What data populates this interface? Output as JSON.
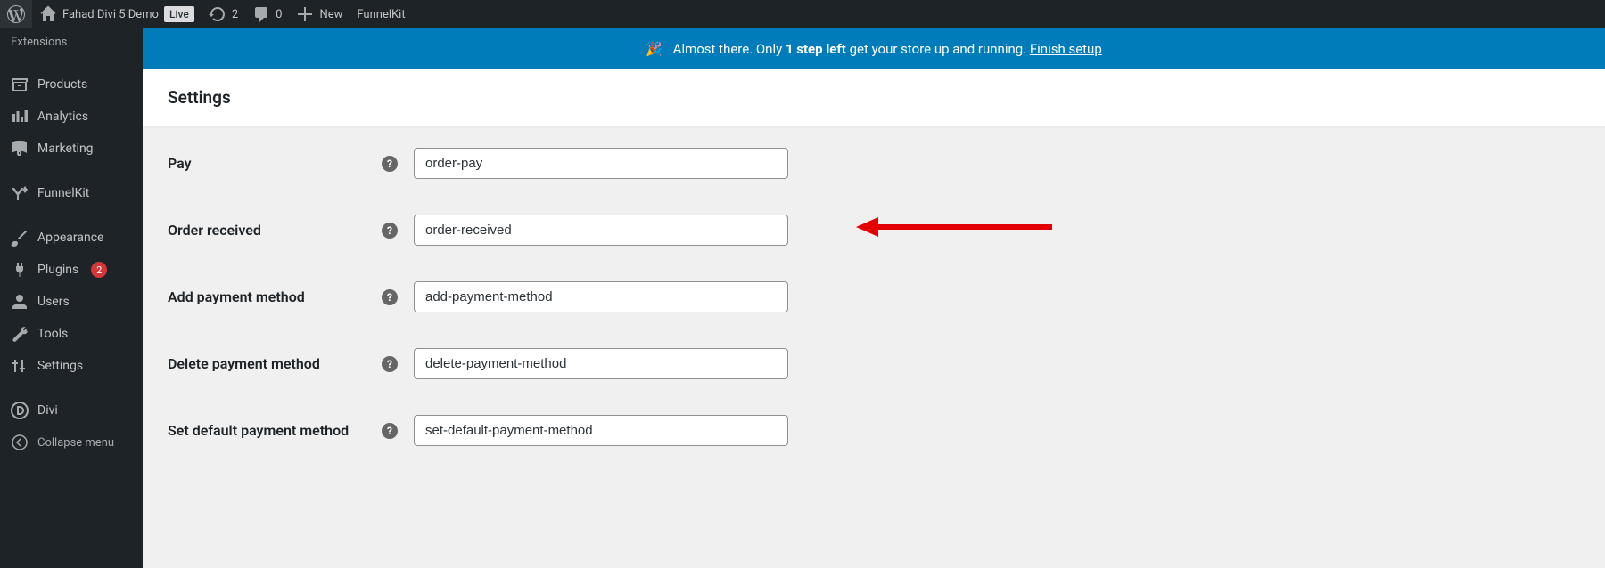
{
  "adminbar": {
    "site_title": "Fahad Divi 5 Demo",
    "live_badge": "Live",
    "refresh_count": "2",
    "comment_count": "0",
    "new_label": "New",
    "funnelkit_label": "FunnelKit"
  },
  "sidebar": {
    "extensions": "Extensions",
    "products": "Products",
    "analytics": "Analytics",
    "marketing": "Marketing",
    "funnelkit": "FunnelKit",
    "appearance": "Appearance",
    "plugins": "Plugins",
    "plugins_count": "2",
    "users": "Users",
    "tools": "Tools",
    "settings": "Settings",
    "divi": "Divi",
    "collapse": "Collapse menu"
  },
  "notice": {
    "pre_text": "Almost there. Only ",
    "bold_text": "1 step left",
    "post_text": " get your store up and running. ",
    "link_text": "Finish setup"
  },
  "page": {
    "title": "Settings"
  },
  "form": {
    "rows": [
      {
        "label": "Pay",
        "value": "order-pay"
      },
      {
        "label": "Order received",
        "value": "order-received"
      },
      {
        "label": "Add payment method",
        "value": "add-payment-method"
      },
      {
        "label": "Delete payment method",
        "value": "delete-payment-method"
      },
      {
        "label": "Set default payment method",
        "value": "set-default-payment-method"
      }
    ]
  }
}
